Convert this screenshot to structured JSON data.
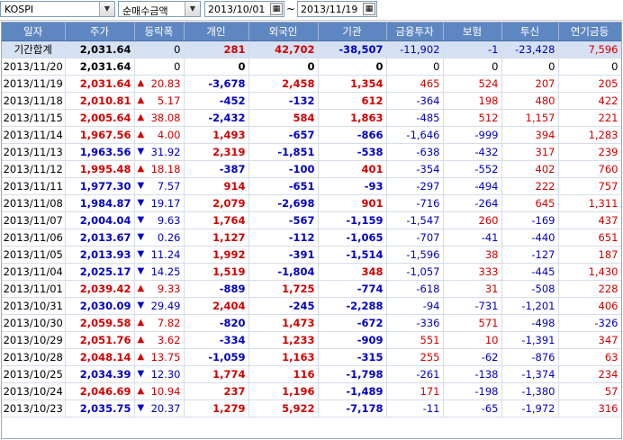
{
  "toolbar": {
    "market": "KOSPI",
    "metric": "순매수금액",
    "date_from": "2013/10/01",
    "date_to": "2013/11/19",
    "tilde": "~"
  },
  "headers": [
    "일자",
    "주가",
    "등락폭",
    "개인",
    "외국인",
    "기관",
    "금융투자",
    "보험",
    "투신",
    "연기금등"
  ],
  "rows": [
    {
      "date": "기간합계",
      "price": "2,031.64",
      "dir": "",
      "chg": "0",
      "ind": "281",
      "frn": "42,702",
      "ins": "-38,507",
      "fin": "-11,902",
      "insur": "-1",
      "trust": "-23,428",
      "pens": "7,596",
      "sum": true
    },
    {
      "date": "2013/11/20",
      "price": "2,031.64",
      "dir": "",
      "chg": "0",
      "ind": "0",
      "frn": "0",
      "ins": "0",
      "fin": "0",
      "insur": "0",
      "trust": "0",
      "pens": "0"
    },
    {
      "date": "2013/11/19",
      "price": "2,031.64",
      "dir": "up",
      "chg": "20.83",
      "ind": "-3,678",
      "frn": "2,458",
      "ins": "1,354",
      "fin": "465",
      "insur": "524",
      "trust": "207",
      "pens": "205"
    },
    {
      "date": "2013/11/18",
      "price": "2,010.81",
      "dir": "up",
      "chg": "5.17",
      "ind": "-452",
      "frn": "-132",
      "ins": "612",
      "fin": "-364",
      "insur": "198",
      "trust": "480",
      "pens": "422"
    },
    {
      "date": "2013/11/15",
      "price": "2,005.64",
      "dir": "up",
      "chg": "38.08",
      "ind": "-2,432",
      "frn": "584",
      "ins": "1,863",
      "fin": "-485",
      "insur": "512",
      "trust": "1,157",
      "pens": "221"
    },
    {
      "date": "2013/11/14",
      "price": "1,967.56",
      "dir": "up",
      "chg": "4.00",
      "ind": "1,493",
      "frn": "-657",
      "ins": "-866",
      "fin": "-1,646",
      "insur": "-999",
      "trust": "394",
      "pens": "1,283"
    },
    {
      "date": "2013/11/13",
      "price": "1,963.56",
      "dir": "dn",
      "chg": "31.92",
      "ind": "2,319",
      "frn": "-1,851",
      "ins": "-538",
      "fin": "-638",
      "insur": "-432",
      "trust": "317",
      "pens": "239"
    },
    {
      "date": "2013/11/12",
      "price": "1,995.48",
      "dir": "up",
      "chg": "18.18",
      "ind": "-387",
      "frn": "-100",
      "ins": "401",
      "fin": "-354",
      "insur": "-552",
      "trust": "402",
      "pens": "760"
    },
    {
      "date": "2013/11/11",
      "price": "1,977.30",
      "dir": "dn",
      "chg": "7.57",
      "ind": "914",
      "frn": "-651",
      "ins": "-93",
      "fin": "-297",
      "insur": "-494",
      "trust": "222",
      "pens": "757"
    },
    {
      "date": "2013/11/08",
      "price": "1,984.87",
      "dir": "dn",
      "chg": "19.17",
      "ind": "2,079",
      "frn": "-2,698",
      "ins": "901",
      "fin": "-716",
      "insur": "-264",
      "trust": "645",
      "pens": "1,311"
    },
    {
      "date": "2013/11/07",
      "price": "2,004.04",
      "dir": "dn",
      "chg": "9.63",
      "ind": "1,764",
      "frn": "-567",
      "ins": "-1,159",
      "fin": "-1,547",
      "insur": "260",
      "trust": "-169",
      "pens": "437"
    },
    {
      "date": "2013/11/06",
      "price": "2,013.67",
      "dir": "dn",
      "chg": "0.26",
      "ind": "1,127",
      "frn": "-112",
      "ins": "-1,065",
      "fin": "-707",
      "insur": "-41",
      "trust": "-440",
      "pens": "651"
    },
    {
      "date": "2013/11/05",
      "price": "2,013.93",
      "dir": "dn",
      "chg": "11.24",
      "ind": "1,992",
      "frn": "-391",
      "ins": "-1,514",
      "fin": "-1,596",
      "insur": "38",
      "trust": "-127",
      "pens": "187"
    },
    {
      "date": "2013/11/04",
      "price": "2,025.17",
      "dir": "dn",
      "chg": "14.25",
      "ind": "1,519",
      "frn": "-1,804",
      "ins": "348",
      "fin": "-1,057",
      "insur": "333",
      "trust": "-445",
      "pens": "1,430"
    },
    {
      "date": "2013/11/01",
      "price": "2,039.42",
      "dir": "up",
      "chg": "9.33",
      "ind": "-889",
      "frn": "1,725",
      "ins": "-774",
      "fin": "-618",
      "insur": "31",
      "trust": "-508",
      "pens": "228"
    },
    {
      "date": "2013/10/31",
      "price": "2,030.09",
      "dir": "dn",
      "chg": "29.49",
      "ind": "2,404",
      "frn": "-245",
      "ins": "-2,288",
      "fin": "-94",
      "insur": "-731",
      "trust": "-1,201",
      "pens": "406"
    },
    {
      "date": "2013/10/30",
      "price": "2,059.58",
      "dir": "up",
      "chg": "7.82",
      "ind": "-820",
      "frn": "1,473",
      "ins": "-672",
      "fin": "-336",
      "insur": "571",
      "trust": "-498",
      "pens": "-326"
    },
    {
      "date": "2013/10/29",
      "price": "2,051.76",
      "dir": "up",
      "chg": "3.62",
      "ind": "-334",
      "frn": "1,233",
      "ins": "-909",
      "fin": "551",
      "insur": "10",
      "trust": "-1,391",
      "pens": "347"
    },
    {
      "date": "2013/10/28",
      "price": "2,048.14",
      "dir": "up",
      "chg": "13.75",
      "ind": "-1,059",
      "frn": "1,163",
      "ins": "-315",
      "fin": "255",
      "insur": "-62",
      "trust": "-876",
      "pens": "63"
    },
    {
      "date": "2013/10/25",
      "price": "2,034.39",
      "dir": "dn",
      "chg": "12.30",
      "ind": "1,774",
      "frn": "116",
      "ins": "-1,798",
      "fin": "-261",
      "insur": "-138",
      "trust": "-1,374",
      "pens": "234"
    },
    {
      "date": "2013/10/24",
      "price": "2,046.69",
      "dir": "up",
      "chg": "10.94",
      "ind": "237",
      "frn": "1,196",
      "ins": "-1,489",
      "fin": "171",
      "insur": "-198",
      "trust": "-1,380",
      "pens": "57"
    },
    {
      "date": "2013/10/23",
      "price": "2,035.75",
      "dir": "dn",
      "chg": "20.37",
      "ind": "1,279",
      "frn": "5,922",
      "ins": "-7,178",
      "fin": "-11",
      "insur": "-65",
      "trust": "-1,972",
      "pens": "316"
    }
  ],
  "colors": {
    "up": "#d40000",
    "down": "#0000c8",
    "header": "#5e87c2",
    "summary_row": "#d6e2f3"
  },
  "icons": {
    "up": "up-triangle-icon",
    "down": "down-triangle-icon",
    "calendar": "calendar-icon",
    "dropdown": "chevron-down-icon"
  }
}
